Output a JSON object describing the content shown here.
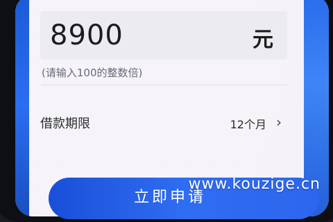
{
  "loan_form": {
    "amount_value": "8900",
    "currency_label": "元",
    "amount_hint": "(请输入100的整数倍)",
    "term_label": "借款期限",
    "term_value": "12个月",
    "apply_button_label": "立即申请"
  },
  "watermark": "www.kouzige.cn",
  "icons": {
    "term_chevron": "chevron-right-icon"
  },
  "colors": {
    "primary_blue": "#2f6df2",
    "screen_background": "#eeebf3",
    "input_background": "#ecebf1"
  }
}
